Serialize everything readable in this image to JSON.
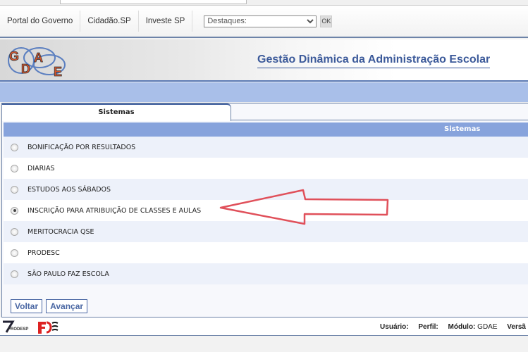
{
  "nav": {
    "links": [
      "Portal do Governo",
      "Cidadão.SP",
      "Investe SP"
    ],
    "destaques_value": "Destaques:",
    "ok_label": "OK"
  },
  "header": {
    "logo_text": "GDAE",
    "title": "Gestão Dinâmica da Administração Escolar"
  },
  "tab": {
    "label": "Sistemas"
  },
  "table": {
    "column_header": "Sistemas",
    "rows": [
      {
        "label": "BONIFICAÇÃO POR RESULTADOS",
        "selected": false
      },
      {
        "label": "DIARIAS",
        "selected": false
      },
      {
        "label": "ESTUDOS AOS SÁBADOS",
        "selected": false
      },
      {
        "label": "INSCRIÇÃO PARA ATRIBUIÇÃO DE CLASSES E AULAS",
        "selected": true
      },
      {
        "label": "MERITOCRACIA QSE",
        "selected": false
      },
      {
        "label": "PRODESC",
        "selected": false
      },
      {
        "label": "SÃO PAULO FAZ ESCOLA",
        "selected": false
      }
    ]
  },
  "buttons": {
    "back": "Voltar",
    "next": "Avançar"
  },
  "footer": {
    "logos": [
      "PRODESP",
      "FDE"
    ],
    "usuario_label": "Usuário:",
    "perfil_label": "Perfil:",
    "modulo_label": "Módulo:",
    "modulo_value": "GDAE",
    "versao_label": "Versã"
  },
  "annotation": {
    "arrow_color": "#e0505a"
  }
}
